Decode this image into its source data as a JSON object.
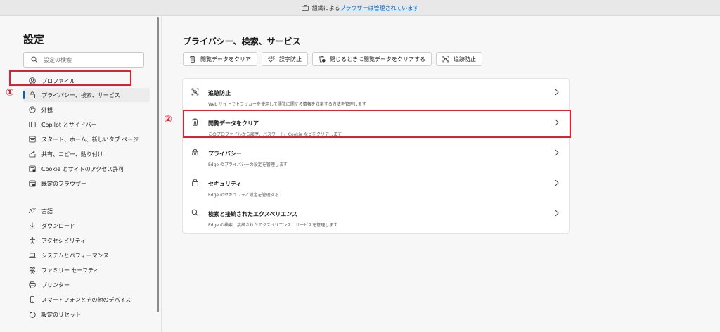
{
  "topbar": {
    "prefix": "組織による",
    "link": "ブラウザーは管理されています"
  },
  "sidebar": {
    "title": "設定",
    "search_placeholder": "設定の検索",
    "items": [
      {
        "label": "プロファイル",
        "icon": "profile-icon"
      },
      {
        "label": "プライバシー、検索、サービス",
        "icon": "lock-icon"
      },
      {
        "label": "外観",
        "icon": "appearance-icon"
      },
      {
        "label": "Copilot とサイドバー",
        "icon": "sidebar-icon"
      },
      {
        "label": "スタート、ホーム、新しいタブ ページ",
        "icon": "home-icon"
      },
      {
        "label": "共有、コピー、貼り付け",
        "icon": "share-icon"
      },
      {
        "label": "Cookie とサイトのアクセス許可",
        "icon": "cookie-icon"
      },
      {
        "label": "既定のブラウザー",
        "icon": "browser-icon"
      },
      {
        "label": "言語",
        "icon": "language-icon"
      },
      {
        "label": "ダウンロード",
        "icon": "download-icon"
      },
      {
        "label": "アクセシビリティ",
        "icon": "accessibility-icon"
      },
      {
        "label": "システムとパフォーマンス",
        "icon": "laptop-icon"
      },
      {
        "label": "ファミリー セーフティ",
        "icon": "family-icon"
      },
      {
        "label": "プリンター",
        "icon": "printer-icon"
      },
      {
        "label": "スマートフォンとその他のデバイス",
        "icon": "phone-icon"
      },
      {
        "label": "設定のリセット",
        "icon": "reset-icon"
      }
    ]
  },
  "markers": {
    "one": "①",
    "two": "②"
  },
  "main": {
    "title": "プライバシー、検索、サービス",
    "chips": [
      {
        "label": "閲覧データをクリア",
        "icon": "trash-icon"
      },
      {
        "label": "誤字防止",
        "icon": "spellcheck-icon"
      },
      {
        "label": "閉じるときに閲覧データをクリアする",
        "icon": "trash-clock-icon"
      },
      {
        "label": "追跡防止",
        "icon": "tracking-icon"
      }
    ],
    "rows": [
      {
        "title": "追跡防止",
        "desc": "Web サイトでトラッカーを使用して閲覧に関する情報を収集する方法を管理します",
        "icon": "tracking-icon"
      },
      {
        "title": "閲覧データをクリア",
        "desc": "このプロファイルから履歴、パスワード、Cookie などをクリアします",
        "icon": "trash-icon"
      },
      {
        "title": "プライバシー",
        "desc": "Edge のプライバシーの設定を管理します",
        "icon": "incognito-icon"
      },
      {
        "title": "セキュリティ",
        "desc": "Edge のセキュリティ設定を管理する",
        "icon": "lock-icon"
      },
      {
        "title": "検索と接続されたエクスペリエンス",
        "desc": "Edge の検索、接続されたエクスペリエンス、サービスを管理します",
        "icon": "search-icon"
      }
    ]
  },
  "colors": {
    "accent": "#0a62c2",
    "highlight": "#e0202e"
  }
}
